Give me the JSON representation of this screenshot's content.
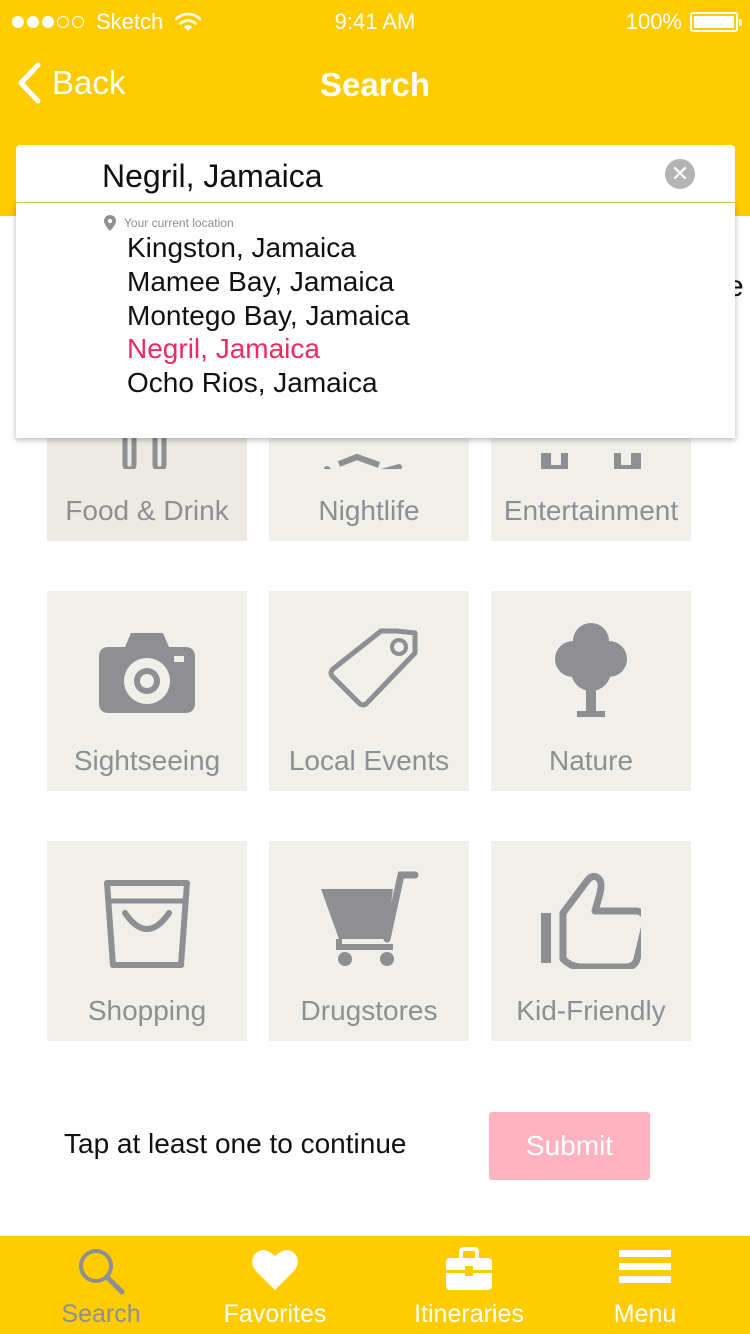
{
  "status_bar": {
    "carrier": "Sketch",
    "time": "9:41 AM",
    "battery": "100%"
  },
  "nav": {
    "back_label": "Back",
    "title": "Search"
  },
  "search": {
    "value": "Negril, Jamaica",
    "current_location_label": "Your current location"
  },
  "suggestions": [
    {
      "label": "Kingston, Jamaica",
      "selected": false
    },
    {
      "label": "Mamee Bay, Jamaica",
      "selected": false
    },
    {
      "label": "Montego Bay, Jamaica",
      "selected": false
    },
    {
      "label": "Negril, Jamaica",
      "selected": true
    },
    {
      "label": "Ocho Rios, Jamaica",
      "selected": false
    }
  ],
  "obscured_text_fragment": "e",
  "categories": [
    {
      "label": "Food & Drink",
      "icon": "fork-knife-icon"
    },
    {
      "label": "Nightlife",
      "icon": "cocktail-icon"
    },
    {
      "label": "Entertainment",
      "icon": "film-icon"
    },
    {
      "label": "Sightseeing",
      "icon": "camera-icon"
    },
    {
      "label": "Local Events",
      "icon": "tag-icon"
    },
    {
      "label": "Nature",
      "icon": "tree-icon"
    },
    {
      "label": "Shopping",
      "icon": "shopping-bag-icon"
    },
    {
      "label": "Drugstores",
      "icon": "cart-icon"
    },
    {
      "label": "Kid-Friendly",
      "icon": "thumbs-up-icon"
    }
  ],
  "footer": {
    "hint": "Tap at least one to continue",
    "submit_label": "Submit"
  },
  "tabs": [
    {
      "label": "Search",
      "icon": "search-icon",
      "active": true
    },
    {
      "label": "Favorites",
      "icon": "heart-icon",
      "active": false
    },
    {
      "label": "Itineraries",
      "icon": "briefcase-icon",
      "active": false
    },
    {
      "label": "Menu",
      "icon": "menu-icon",
      "active": false
    }
  ],
  "colors": {
    "brand_yellow": "#FFCC00",
    "tile_bg": "#F0EFEA",
    "icon_gray": "#8E8E93",
    "accent_pink": "#EE2A5F",
    "submit_disabled": "#FFB3C1"
  }
}
